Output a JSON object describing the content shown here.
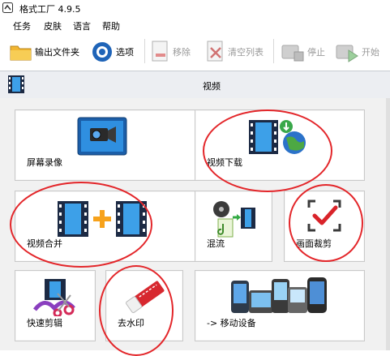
{
  "window": {
    "title": "格式工厂 4.9.5"
  },
  "menu": [
    "任务",
    "皮肤",
    "语言",
    "帮助"
  ],
  "toolbar": {
    "output_folder": "输出文件夹",
    "options": "选项",
    "remove": "移除",
    "clear_list": "清空列表",
    "stop": "停止",
    "start": "开始"
  },
  "section": {
    "title": "视频"
  },
  "tiles": {
    "screen_record": "屏幕录像",
    "video_download": "视频下载",
    "video_merge": "视频合并",
    "mix": "混流",
    "crop": "画面裁剪",
    "quick_cut": "快速剪辑",
    "remove_watermark": "去水印",
    "mobile_device": "-> 移动设备"
  },
  "colors": {
    "annotation_red": "#e3262a",
    "accent_blue": "#2a7fd4"
  }
}
